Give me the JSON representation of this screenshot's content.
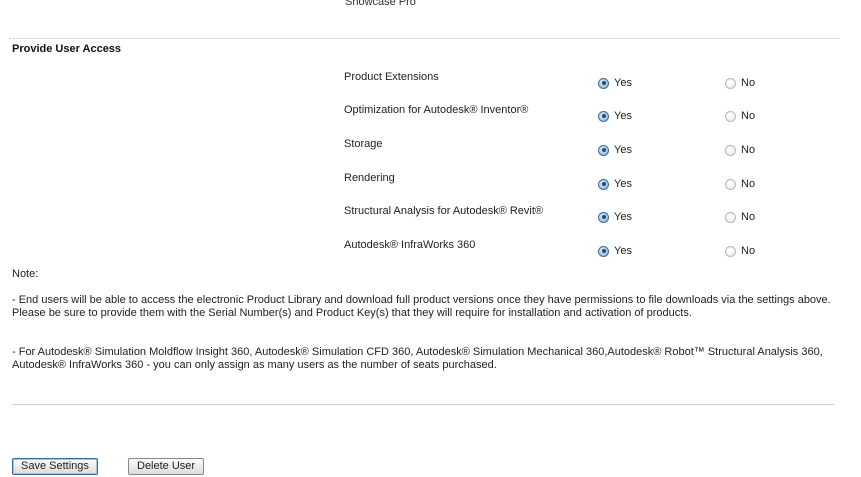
{
  "header": {
    "truncated_product": "Showcase Pro"
  },
  "section": {
    "title": "Provide User Access"
  },
  "options": {
    "yes_label": "Yes",
    "no_label": "No"
  },
  "access_rows": [
    {
      "label": "Product Extensions",
      "value": "Yes"
    },
    {
      "label": "Optimization for Autodesk® Inventor®",
      "value": "Yes"
    },
    {
      "label": "Storage",
      "value": "Yes"
    },
    {
      "label": "Rendering",
      "value": "Yes"
    },
    {
      "label": "Structural Analysis for Autodesk® Revit®",
      "value": "Yes"
    },
    {
      "label": "Autodesk® InfraWorks 360",
      "value": "Yes"
    }
  ],
  "note": {
    "heading": "Note:",
    "paragraphs": [
      "- End users will be able to access the electronic Product Library and download full product versions once they have permissions to file downloads via the settings above. Please be sure to provide them with the Serial Number(s) and Product Key(s) that they will require for installation and activation of products.",
      "- For Autodesk® Simulation Moldflow Insight 360, Autodesk® Simulation CFD 360, Autodesk® Simulation Mechanical 360,Autodesk® Robot™ Structural Analysis 360, Autodesk® InfraWorks 360 - you can only assign as many users as the number of seats purchased."
    ]
  },
  "buttons": {
    "save_label": "Save Settings",
    "delete_label": "Delete User"
  },
  "colors": {
    "radio_checked": "#3d6f9a",
    "radio_unchecked": "#b8b8b8",
    "divider": "#cfcfcf"
  }
}
